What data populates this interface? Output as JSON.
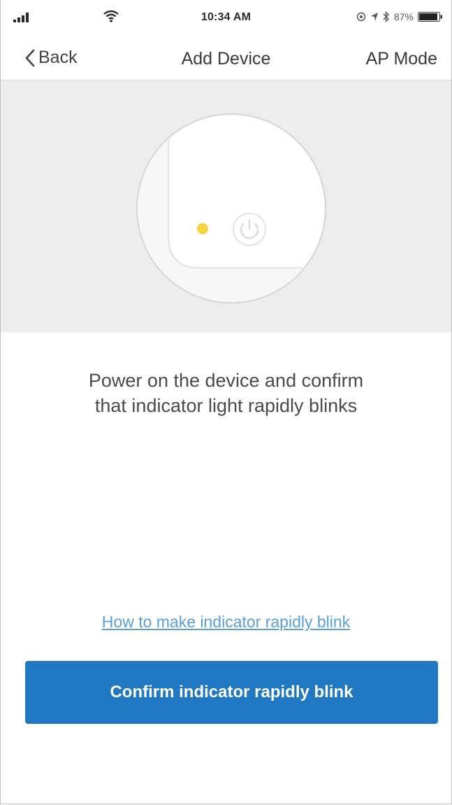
{
  "status_bar": {
    "time": "10:34 AM",
    "battery_percent": "87%",
    "icons": [
      "signal-icon",
      "wifi-icon",
      "location-icon",
      "bluetooth-icon",
      "battery-icon"
    ]
  },
  "nav": {
    "back_label": "Back",
    "title": "Add Device",
    "right_label": "AP Mode"
  },
  "illustration": {
    "indicator_color": "#f5d442",
    "icons": [
      "indicator-light-icon",
      "power-icon"
    ]
  },
  "instruction": {
    "line1": "Power on the device and confirm",
    "line2": "that indicator light rapidly blinks"
  },
  "help_link": "How to make indicator rapidly blink",
  "confirm_button": "Confirm indicator rapidly blink",
  "colors": {
    "accent": "#1f78c1",
    "link": "#5a9fd6",
    "hero_background": "#ededed"
  }
}
